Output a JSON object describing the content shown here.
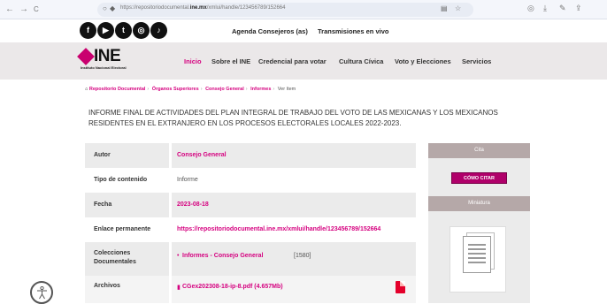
{
  "browser": {
    "back_icon": "←",
    "forward_icon": "→",
    "reload_icon": "C",
    "url_prefix": "https://repositoriodocumental.",
    "url_domain": "ine.mx",
    "url_suffix": "/xmlui/handle/123456789/152664"
  },
  "top_links": [
    "Agenda Consejeros (as)",
    "Transmisiones en vivo"
  ],
  "social_icons": [
    "facebook-icon",
    "youtube-icon",
    "twitter-icon",
    "instagram-icon",
    "tiktok-icon"
  ],
  "logo": {
    "text": "INE",
    "subtitle": "Instituto Nacional Electoral"
  },
  "nav": {
    "items": [
      "Inicio",
      "Sobre el INE",
      "Credencial para votar",
      "Cultura Cívica",
      "Voto y Elecciones",
      "Servicios"
    ],
    "active_index": 0
  },
  "breadcrumb": {
    "items": [
      "Repositorio Documental",
      "Órganos Superiores",
      "Consejo General",
      "Informes"
    ],
    "current": "Ver ítem"
  },
  "title": "INFORME FINAL DE ACTIVIDADES DEL PLAN INTEGRAL DE TRABAJO DEL VOTO DE LAS MEXICANAS Y LOS MEXICANOS RESIDENTES EN EL EXTRANJERO EN LOS PROCESOS ELECTORALES LOCALES 2022-2023.",
  "metadata": {
    "author_label": "Autor",
    "author_value": "Consejo General",
    "type_label": "Tipo de contenido",
    "type_value": "Informe",
    "date_label": "Fecha",
    "date_value": "2023-08-18",
    "permalink_label": "Enlace permanente",
    "permalink_value": "https://repositoriodocumental.ine.mx/xmlui/handle/123456789/152664",
    "collections_label": "Colecciones Documentales",
    "collection_link": "Informes - Consejo General",
    "collection_count": "[1580]",
    "files_label": "Archivos",
    "file_name": "CGex202308-18-ip-8.pdf (4.657Mb)"
  },
  "sidebar": {
    "cite_header": "Cita",
    "cite_button": "CÓMO CITAR",
    "thumb_header": "Miniatura"
  },
  "colors": {
    "brand_pink": "#d5007f",
    "nav_bg": "#ebe8e9",
    "side_header": "#b5a8a8"
  }
}
